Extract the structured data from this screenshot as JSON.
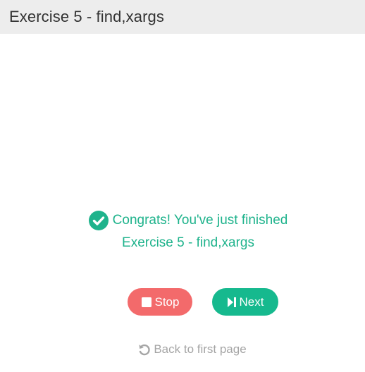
{
  "header": {
    "title": "Exercise 5 - find,xargs"
  },
  "message": {
    "line1": "Congrats! You've just finished",
    "line2": "Exercise 5 - find,xargs",
    "icon": "check-circle-icon",
    "color": "#1fb38c"
  },
  "buttons": {
    "stop_label": "Stop",
    "stop_icon": "stop-icon",
    "stop_color": "#f36a6b",
    "next_label": "Next",
    "next_icon": "skip-forward-icon",
    "next_color": "#16b98e"
  },
  "back_link": {
    "label": "Back to first page",
    "icon": "undo-icon"
  }
}
